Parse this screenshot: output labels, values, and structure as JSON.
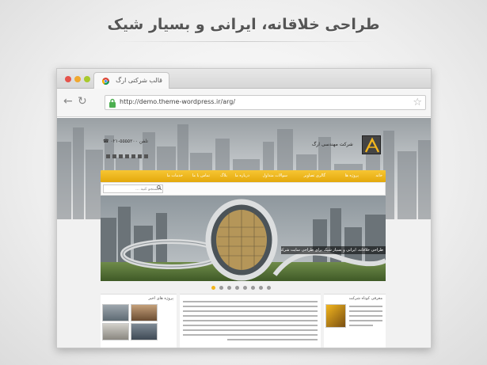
{
  "headline": "طراحی خلاقانه، ایرانی و بسیار شیک",
  "browser": {
    "tab_title": "قالب شرکتی ارگ",
    "url": "http://demo.theme-wordpress.ir/arg/",
    "controls": {
      "close_color": "#e5534b",
      "minimize_color": "#f0a82f",
      "maximize_color": "#a8c92c"
    }
  },
  "site": {
    "phone": "۰۲۱-۵۵۵۵۲۰۰",
    "phone_label": "تلفن",
    "logo_tagline": "شرکت مهندسی ارگ",
    "menu": [
      "خانه",
      "پروژه ها",
      "گالری تصاویر",
      "سوالات متداول",
      "درباره ما",
      "بلاگ",
      "تماس با ما",
      "خدمات ما"
    ],
    "search_placeholder": "جستجو کنید ...",
    "slider_caption": "طراحی خلاقانه، ایرانی و بسیار شیک برای طراحی سایت شرکتی",
    "slider_dots": 8,
    "sections": {
      "projects_title": "پروژه های اخیر",
      "about_title": "معرفی کوتاه شرکت"
    },
    "accent": "#f2b61e"
  }
}
